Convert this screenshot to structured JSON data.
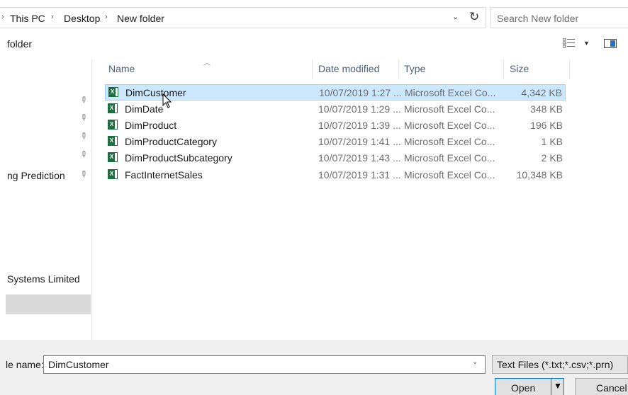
{
  "address": {
    "lead_chevron": "›",
    "crumbs": [
      "This PC",
      "Desktop",
      "New folder"
    ],
    "separator": "›",
    "dropdown_glyph": "⌄",
    "refresh_glyph": "↻"
  },
  "search": {
    "placeholder": "Search New folder"
  },
  "toolbar": {
    "folder_label": "folder"
  },
  "nav": {
    "items": [
      "ng Prediction",
      "Systems Limited"
    ],
    "pin_glyph": "📌"
  },
  "columns": {
    "name": "Name",
    "date": "Date modified",
    "type": "Type",
    "size": "Size"
  },
  "files": [
    {
      "name": "DimCustomer",
      "date": "10/07/2019 1:27 ...",
      "type": "Microsoft Excel Co...",
      "size": "4,342 KB",
      "selected": true
    },
    {
      "name": "DimDate",
      "date": "10/07/2019 1:29 ...",
      "type": "Microsoft Excel Co...",
      "size": "348 KB",
      "selected": false
    },
    {
      "name": "DimProduct",
      "date": "10/07/2019 1:39 ...",
      "type": "Microsoft Excel Co...",
      "size": "196 KB",
      "selected": false
    },
    {
      "name": "DimProductCategory",
      "date": "10/07/2019 1:41 ...",
      "type": "Microsoft Excel Co...",
      "size": "1 KB",
      "selected": false
    },
    {
      "name": "DimProductSubcategory",
      "date": "10/07/2019 1:43 ...",
      "type": "Microsoft Excel Co...",
      "size": "2 KB",
      "selected": false
    },
    {
      "name": "FactInternetSales",
      "date": "10/07/2019 1:31 ...",
      "type": "Microsoft Excel Co...",
      "size": "10,348 KB",
      "selected": false
    }
  ],
  "filename": {
    "label": "le name:",
    "value": "DimCustomer"
  },
  "filetype": {
    "value": "Text Files (*.txt;*.csv;*.prn)"
  },
  "buttons": {
    "open": "Open",
    "cancel": "Cancel"
  },
  "colors": {
    "selection_bg": "#cce8ff",
    "selection_border": "#99d1ff",
    "accent": "#0078d7",
    "excel_green": "#1d6f42"
  },
  "icons": {
    "file": "excel-file-icon",
    "view": "details-view-icon",
    "pane": "preview-pane-icon",
    "refresh": "refresh-icon",
    "pin": "pin-icon"
  }
}
